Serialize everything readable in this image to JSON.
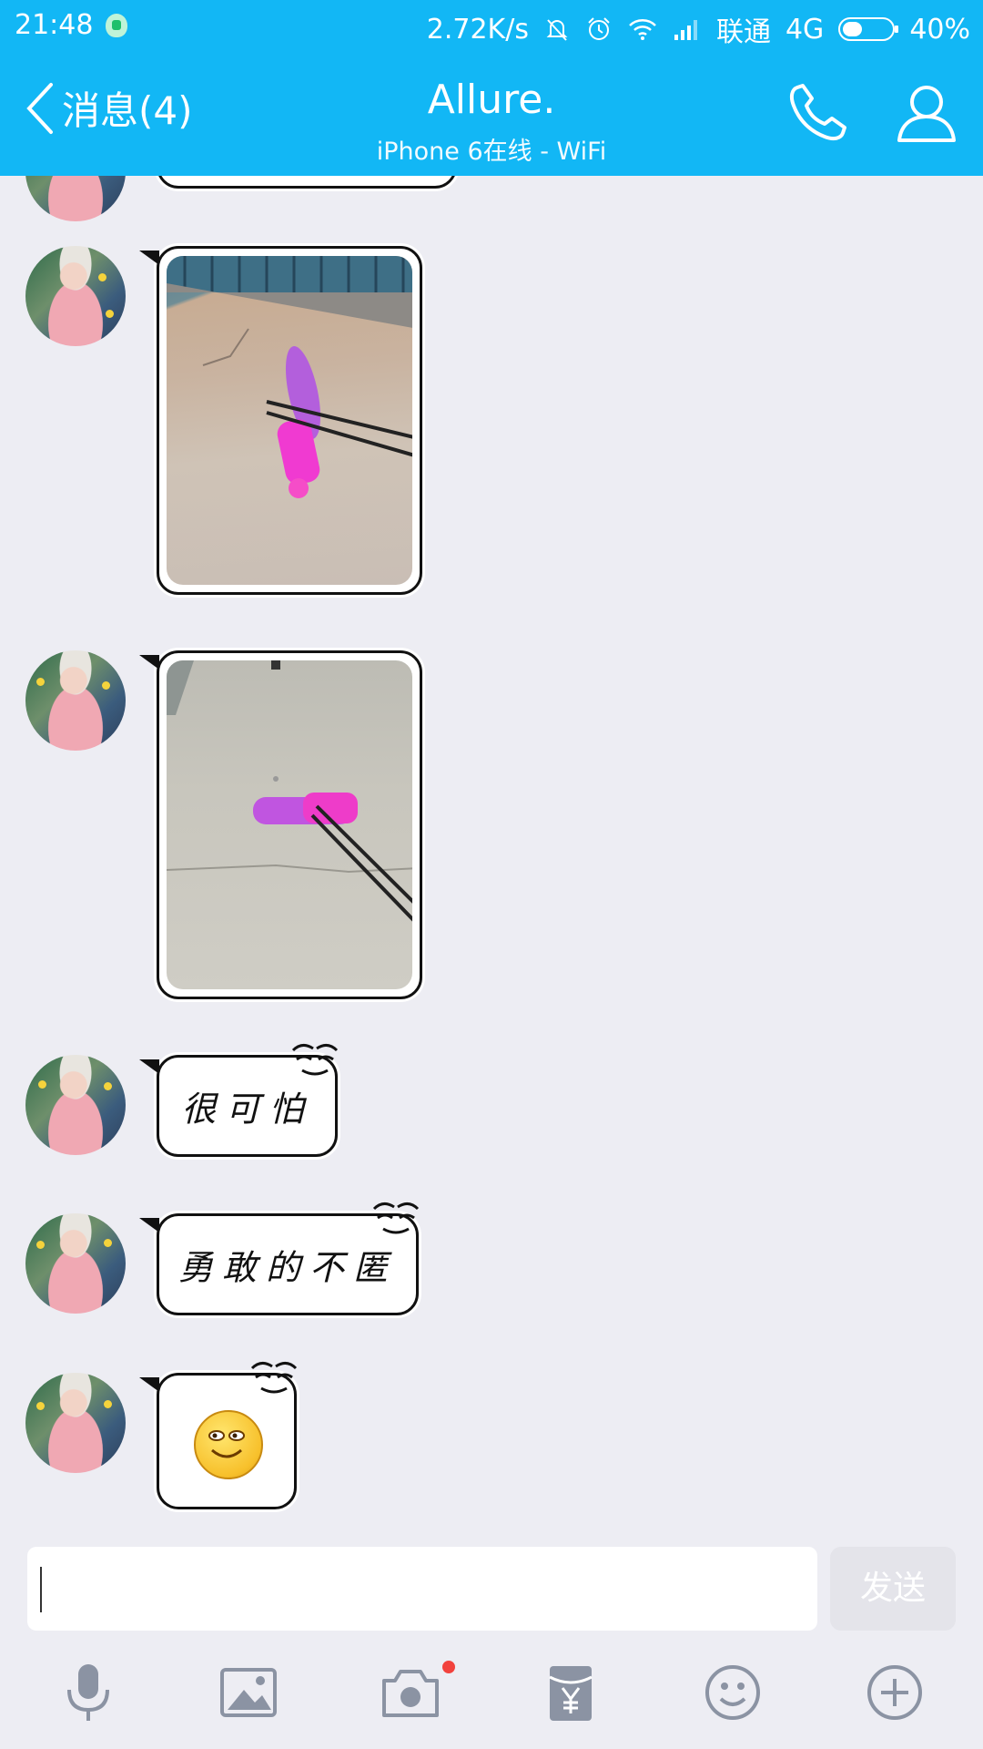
{
  "status_bar": {
    "time": "21:48",
    "net_speed": "2.72K/s",
    "carrier": "联通",
    "network": "4G",
    "battery": "40%",
    "battery_level": 0.4
  },
  "header": {
    "back_label": "消息(4)",
    "title": "Allure.",
    "subtitle": "iPhone 6在线 - WiFi"
  },
  "messages": [
    {
      "type": "image",
      "icon": "photo"
    },
    {
      "type": "image",
      "icon": "photo"
    },
    {
      "type": "text",
      "text": "很可怕"
    },
    {
      "type": "text",
      "text": "勇敢的不匿"
    },
    {
      "type": "emoji",
      "icon": "smiley-face"
    }
  ],
  "composer": {
    "input_value": "",
    "send_label": "发送"
  },
  "toolbar": {
    "icons": [
      "microphone-icon",
      "image-icon",
      "camera-icon",
      "red-packet-icon",
      "emoji-icon",
      "plus-icon"
    ]
  },
  "colors": {
    "brand": "#12b7f5",
    "chat_background": "#ededf3",
    "notification_dot": "#f2423d"
  }
}
